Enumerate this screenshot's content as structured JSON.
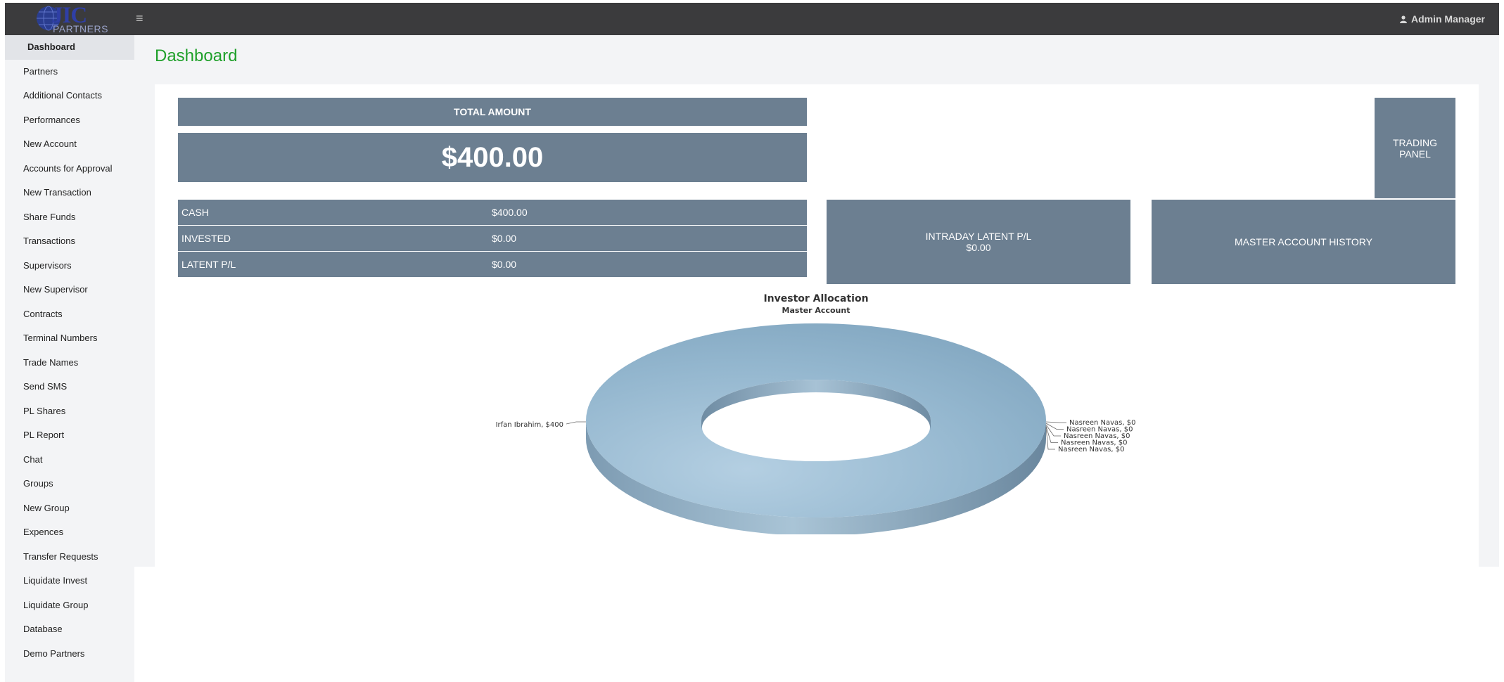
{
  "header": {
    "logo_main": "JIC",
    "logo_sub": "PARTNERS",
    "user_name": "Admin Manager"
  },
  "sidebar": {
    "items": [
      {
        "label": "Dashboard",
        "active": true
      },
      {
        "label": "Partners"
      },
      {
        "label": "Additional Contacts"
      },
      {
        "label": "Performances"
      },
      {
        "label": "New Account"
      },
      {
        "label": "Accounts for Approval"
      },
      {
        "label": "New Transaction"
      },
      {
        "label": "Share Funds"
      },
      {
        "label": "Transactions"
      },
      {
        "label": "Supervisors"
      },
      {
        "label": "New Supervisor"
      },
      {
        "label": "Contracts"
      },
      {
        "label": "Terminal Numbers"
      },
      {
        "label": "Trade Names"
      },
      {
        "label": "Send SMS"
      },
      {
        "label": "PL Shares"
      },
      {
        "label": "PL Report"
      },
      {
        "label": "Chat"
      },
      {
        "label": "Groups"
      },
      {
        "label": "New Group"
      },
      {
        "label": "Expences"
      },
      {
        "label": "Transfer Requests"
      },
      {
        "label": "Liquidate Invest"
      },
      {
        "label": "Liquidate Group"
      },
      {
        "label": "Database"
      },
      {
        "label": "Demo Partners"
      }
    ]
  },
  "page": {
    "title": "Dashboard"
  },
  "summary": {
    "total_label": "TOTAL AMOUNT",
    "total_value": "$400.00",
    "rows": [
      {
        "label": "CASH",
        "value": "$400.00"
      },
      {
        "label": "INVESTED",
        "value": "$0.00"
      },
      {
        "label": "LATENT P/L",
        "value": "$0.00"
      }
    ]
  },
  "intraday": {
    "label": "INTRADAY LATENT P/L",
    "value": "$0.00"
  },
  "history": {
    "label": "MASTER ACCOUNT HISTORY"
  },
  "trading": {
    "line1": "TRADING",
    "line2": "PANEL"
  },
  "colors": {
    "topbar": "#3b3b3d",
    "tile": "#6c7f91",
    "title_green": "#1fa02a",
    "donut": "#8fb3cc"
  },
  "chart_data": {
    "type": "pie",
    "style": "3d-donut",
    "title": "Investor Allocation",
    "subtitle": "Master Account",
    "slices": [
      {
        "name": "Irfan Ibrahim",
        "value": 400,
        "label": "Irfan Ibrahim, $400"
      },
      {
        "name": "Nasreen Navas",
        "value": 0,
        "label": "Nasreen Navas, $0"
      },
      {
        "name": "Nasreen Navas",
        "value": 0,
        "label": "Nasreen Navas, $0"
      },
      {
        "name": "Nasreen Navas",
        "value": 0,
        "label": "Nasreen Navas, $0"
      },
      {
        "name": "Nasreen Navas",
        "value": 0,
        "label": "Nasreen Navas, $0"
      },
      {
        "name": "Nasreen Navas",
        "value": 0,
        "label": "Nasreen Navas, $0"
      }
    ]
  }
}
